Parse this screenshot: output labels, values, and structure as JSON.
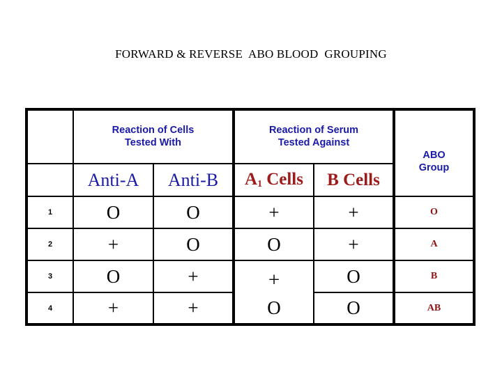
{
  "slide": {
    "title": "FORWARD & REVERSE  ABO BLOOD  GROUPING",
    "background_color": "#ffffff"
  },
  "colors": {
    "header_blue": "#1a1aa8",
    "cells_red": "#9e1b1b",
    "abo_red": "#8e1414",
    "border": "#000000",
    "text_black": "#000000"
  },
  "table": {
    "group_headers": {
      "cells_tested": "Reaction of Cells\nTested With",
      "serum_tested": "Reaction of Serum\nTested Against",
      "abo_group": "ABO\nGroup",
      "corner_blank": ""
    },
    "column_headers": {
      "blank": "",
      "anti_a": "Anti-A",
      "anti_b": "Anti-B",
      "a1_cells_prefix": "A",
      "a1_cells_sub": "1",
      "a1_cells_suffix": " Cells",
      "b_cells": "B Cells"
    },
    "rows": [
      {
        "number": "1",
        "anti_a": "O",
        "anti_b": "O",
        "a1_cells": "+",
        "b_cells": "+",
        "abo_group": "O"
      },
      {
        "number": "2",
        "anti_a": "+",
        "anti_b": "O",
        "a1_cells": "O",
        "b_cells": "+",
        "abo_group": "A"
      },
      {
        "number": "3",
        "anti_a": "O",
        "anti_b": "+",
        "a1_cells": "+",
        "b_cells": "O",
        "abo_group": "B"
      },
      {
        "number": "4",
        "anti_a": "+",
        "anti_b": "+",
        "a1_cells": "O",
        "b_cells": "O",
        "abo_group": "AB"
      }
    ]
  }
}
